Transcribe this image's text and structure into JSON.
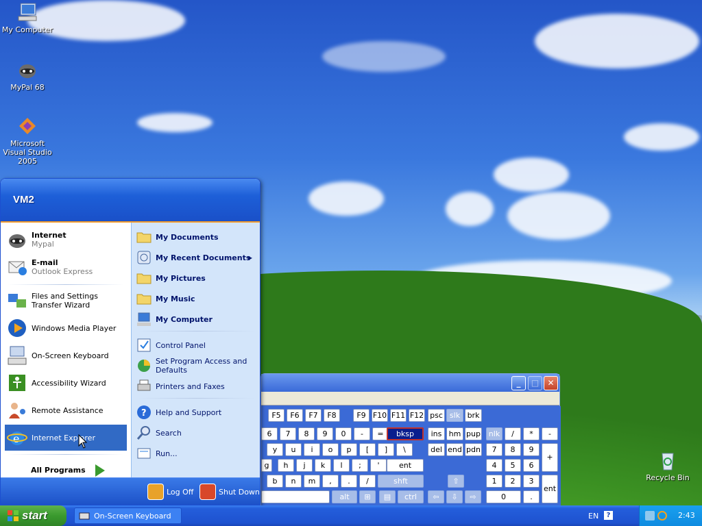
{
  "desktop": {
    "icons": [
      {
        "label": "My Computer",
        "icon": "my-computer-icon"
      },
      {
        "label": "MyPal 68",
        "icon": "mypal-icon"
      },
      {
        "label": "Microsoft Visual Studio 2005",
        "icon": "visual-studio-icon"
      },
      {
        "label": "Recycle Bin",
        "icon": "recycle-bin-icon"
      }
    ]
  },
  "start_menu": {
    "user": "VM2",
    "pinned": [
      {
        "title": "Internet",
        "sub": "Mypal",
        "icon": "mypal-icon"
      },
      {
        "title": "E-mail",
        "sub": "Outlook Express",
        "icon": "outlook-express-icon"
      }
    ],
    "recent": [
      {
        "label": "Files and Settings Transfer Wizard",
        "icon": "transfer-wizard-icon"
      },
      {
        "label": "Windows Media Player",
        "icon": "media-player-icon"
      },
      {
        "label": "On-Screen Keyboard",
        "icon": "keyboard-icon"
      },
      {
        "label": "Accessibility Wizard",
        "icon": "accessibility-icon"
      },
      {
        "label": "Remote Assistance",
        "icon": "remote-assistance-icon"
      },
      {
        "label": "Internet Explorer",
        "icon": "internet-explorer-icon"
      }
    ],
    "all_programs": "All Programs",
    "right": {
      "my_documents": "My Documents",
      "my_recent": "My Recent Documents",
      "my_pictures": "My Pictures",
      "my_music": "My Music",
      "my_computer": "My Computer",
      "control_panel": "Control Panel",
      "set_program": "Set Program Access and Defaults",
      "printers": "Printers and Faxes",
      "help": "Help and Support",
      "search": "Search",
      "run": "Run..."
    },
    "log_off": "Log Off",
    "shut_down": "Shut Down"
  },
  "osk": {
    "buttons": {
      "minimize": "_",
      "maximize": "□",
      "close": "✕"
    },
    "fkeys": [
      "F5",
      "F6",
      "F7",
      "F8",
      "F9",
      "F10",
      "F11",
      "F12"
    ],
    "row1": [
      "6",
      "7",
      "8",
      "9",
      "0",
      "-",
      "=",
      "bksp"
    ],
    "row2": [
      "y",
      "u",
      "i",
      "o",
      "p",
      "[",
      "]",
      "\\"
    ],
    "row3": [
      "g",
      "h",
      "j",
      "k",
      "l",
      ";",
      "'",
      "ent"
    ],
    "row4": [
      "b",
      "n",
      "m",
      ",",
      ".",
      "/",
      "shft"
    ],
    "row5": [
      "alt",
      "ctrl"
    ],
    "nav": [
      "psc",
      "slk",
      "brk",
      "ins",
      "hm",
      "pup",
      "del",
      "end",
      "pdn"
    ],
    "numpad": [
      "nlk",
      "/",
      "*",
      "-",
      "7",
      "8",
      "9",
      "+",
      "4",
      "5",
      "6",
      "1",
      "2",
      "3",
      "ent",
      "0",
      "."
    ]
  },
  "taskbar": {
    "start": "start",
    "task": "On-Screen Keyboard",
    "lang": "EN",
    "clock": "2:43"
  }
}
